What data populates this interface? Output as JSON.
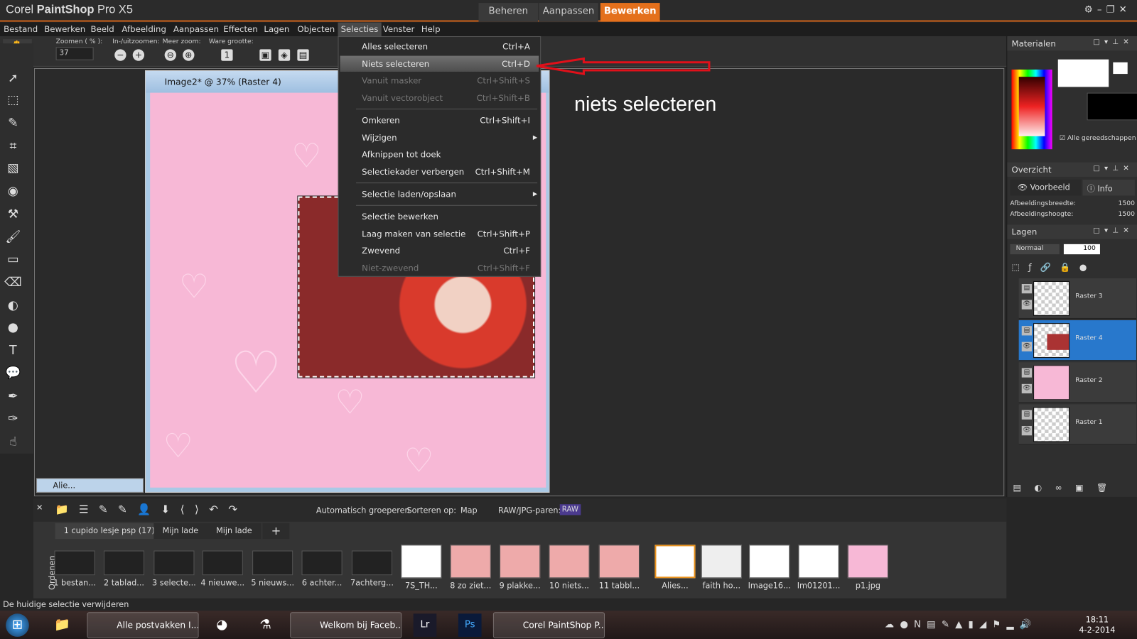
{
  "app": {
    "brand_light": "Corel ",
    "brand_bold": "PaintShop",
    "brand_tail": " Pro X5",
    "modes": [
      "Beheren",
      "Aanpassen",
      "Bewerken"
    ],
    "active_mode": "Bewerken",
    "accent": "#e4701c"
  },
  "menubar": [
    "Bestand",
    "Bewerken",
    "Beeld",
    "Afbeelding",
    "Aanpassen",
    "Effecten",
    "Lagen",
    "Objecten",
    "Selecties",
    "Venster",
    "Help"
  ],
  "toolbar": {
    "zoom_label": "Zoomen ( % ):",
    "zoom_value": "37",
    "inout_label": "In-/uitzoomen:",
    "more_label": "Meer zoom:",
    "actual_label": "Ware grootte:"
  },
  "selecties_menu": [
    {
      "label": "Alles selecteren",
      "shortcut": "Ctrl+A",
      "state": "enabled"
    },
    {
      "label": "Niets selecteren",
      "shortcut": "Ctrl+D",
      "state": "highlighted"
    },
    {
      "label": "Vanuit masker",
      "shortcut": "Ctrl+Shift+S",
      "state": "disabled"
    },
    {
      "label": "Vanuit vectorobject",
      "shortcut": "Ctrl+Shift+B",
      "state": "disabled"
    },
    {
      "label": "Omkeren",
      "shortcut": "Ctrl+Shift+I",
      "state": "enabled"
    },
    {
      "label": "Wijzigen",
      "shortcut": "",
      "state": "submenu"
    },
    {
      "label": "Afknippen tot doek",
      "shortcut": "",
      "state": "enabled"
    },
    {
      "label": "Selectiekader verbergen",
      "shortcut": "Ctrl+Shift+M",
      "state": "enabled"
    },
    {
      "label": "Selectie laden/opslaan",
      "shortcut": "",
      "state": "submenu"
    },
    {
      "label": "Selectie bewerken",
      "shortcut": "",
      "state": "enabled"
    },
    {
      "label": "Laag maken van selectie",
      "shortcut": "Ctrl+Shift+P",
      "state": "enabled"
    },
    {
      "label": "Zwevend",
      "shortcut": "Ctrl+F",
      "state": "enabled"
    },
    {
      "label": "Niet-zwevend",
      "shortcut": "Ctrl+Shift+F",
      "state": "disabled"
    }
  ],
  "annotation": "niets selecteren",
  "image_window": {
    "title": "Image2* @  37% (Raster 4)",
    "minimized_title": "Alie..."
  },
  "materials": {
    "title": "Materialen",
    "all_tools": "Alle gereedschappen"
  },
  "overview": {
    "title": "Overzicht",
    "tab_preview": "Voorbeeld",
    "tab_info": "Info",
    "width_label": "Afbeeldingsbreedte:",
    "width": "1500",
    "height_label": "Afbeeldingshoogte:",
    "height": "1500"
  },
  "layers": {
    "title": "Lagen",
    "blend": "Normaal",
    "opacity": "100",
    "items": [
      "Raster 3",
      "Raster 4",
      "Raster 2",
      "Raster 1"
    ],
    "selected": "Raster 4"
  },
  "organizer": {
    "auto_group": "Automatisch groeperen",
    "sort_label": "Sorteren op:",
    "sort_value": "Map",
    "raw_label": "RAW/JPG-paren:",
    "raw_badge": "RAW",
    "side_label": "Ordenen",
    "tabs": [
      "1 cupido lesje psp (17)",
      "Mijn lade",
      "Mijn lade"
    ],
    "add_tab": "+",
    "thumbs": [
      "1 bestan...",
      "2 tablad...",
      "3 selecte...",
      "4 nieuwe...",
      "5 nieuws...",
      "6 achter...",
      "7achterg...",
      "7S_TH...",
      "8 zo ziet...",
      "9 plakke...",
      "10 niets...",
      "11 tabbl...",
      "Alies...",
      "faith ho...",
      "Image16...",
      "Im01201...",
      "p1.jpg"
    ]
  },
  "status": "De huidige selectie verwijderen",
  "taskbar": {
    "items": [
      "Alle postvakken I...",
      "Welkom bij Faceb...",
      "Corel PaintShop P..."
    ],
    "time": "18:11",
    "date": "4-2-2014"
  }
}
